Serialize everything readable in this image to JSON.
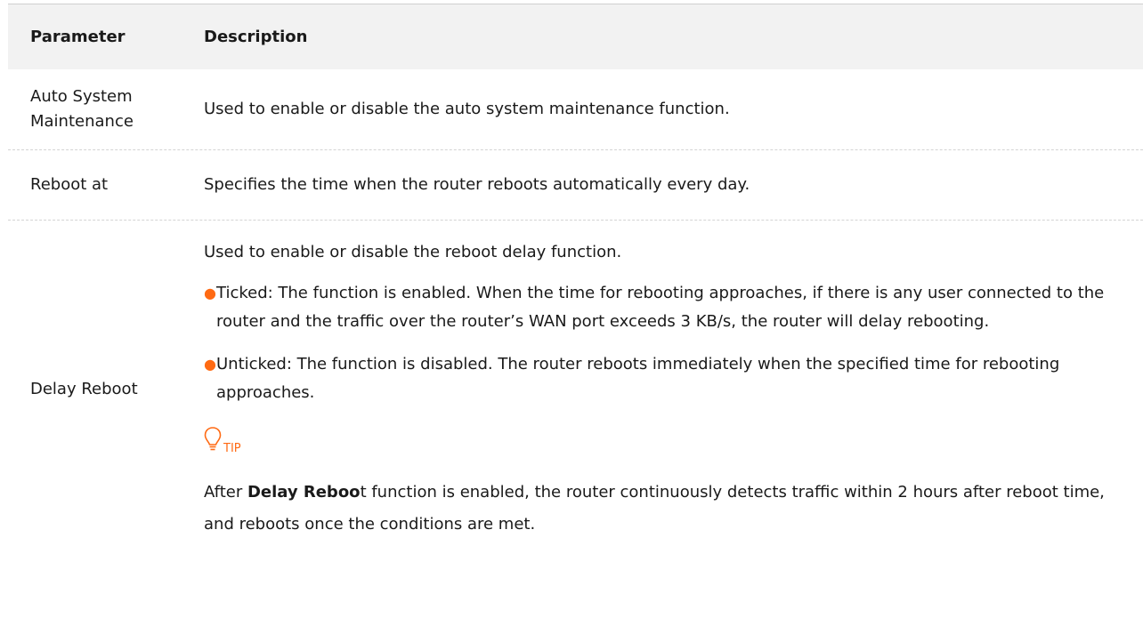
{
  "table": {
    "header": {
      "parameter": "Parameter",
      "description": "Description"
    },
    "rows": [
      {
        "parameter": "Auto System Maintenance",
        "description": "Used to enable or disable the auto system maintenance function."
      },
      {
        "parameter": "Reboot at",
        "description": "Specifies the time when the router reboots automatically every day."
      },
      {
        "parameter": "Delay Reboot",
        "description": "Used to enable or disable the reboot delay function.",
        "bullets": [
          "Ticked: The function is enabled. When the time for rebooting approaches, if there is any user connected to the router and the traffic over the router’s WAN port exceeds 3 KB/s, the router will delay rebooting.",
          "Unticked: The function is disabled. The router reboots immediately when the specified time for rebooting approaches."
        ],
        "tip_label": "TIP",
        "tip_prefix": "After ",
        "tip_bold": "Delay Reboo",
        "tip_rest": "t function is enabled, the router continuously detects traffic within 2 hours after reboot time, and reboots once the conditions are met."
      }
    ]
  },
  "colors": {
    "accent": "#ff6a13",
    "header_bg": "#f2f2f2"
  },
  "icons": {
    "tip": "lightbulb-icon"
  }
}
